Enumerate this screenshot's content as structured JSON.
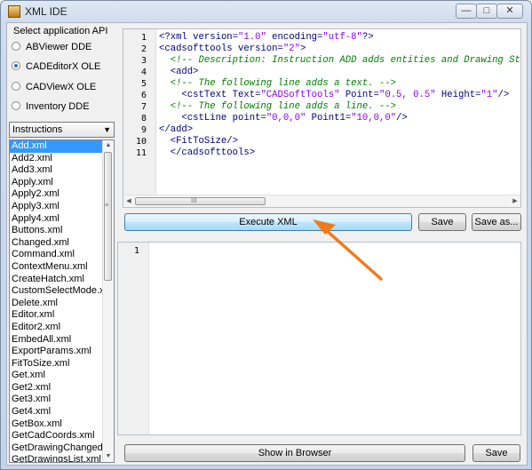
{
  "window": {
    "title": "XML IDE",
    "icon": "xml-ide-app-icon",
    "controls": {
      "minimize": "—",
      "maximize": "□",
      "close": "✕"
    }
  },
  "api": {
    "label": "Select application API",
    "options": [
      {
        "label": "ABViewer DDE",
        "selected": false
      },
      {
        "label": "CADEditorX OLE",
        "selected": true
      },
      {
        "label": "CADViewX OLE",
        "selected": false
      },
      {
        "label": "Inventory DDE",
        "selected": false
      }
    ]
  },
  "instructions": {
    "selected": "Instructions",
    "files": [
      "Add.xml",
      "Add2.xml",
      "Add3.xml",
      "Apply.xml",
      "Apply2.xml",
      "Apply3.xml",
      "Apply4.xml",
      "Buttons.xml",
      "Changed.xml",
      "Command.xml",
      "ContextMenu.xml",
      "CreateHatch.xml",
      "CustomSelectMode.xml",
      "Delete.xml",
      "Editor.xml",
      "Editor2.xml",
      "EmbedAll.xml",
      "ExportParams.xml",
      "FitToSize.xml",
      "Get.xml",
      "Get2.xml",
      "Get3.xml",
      "Get4.xml",
      "GetBox.xml",
      "GetCadCoords.xml",
      "GetDrawingChanged.xml",
      "GetDrawingsList.xml"
    ],
    "selected_file": "Add.xml"
  },
  "editor": {
    "line_numbers": [
      "1",
      "2",
      "3",
      "4",
      "5",
      "6",
      "7",
      "8",
      "9",
      "10",
      "11"
    ],
    "lines": [
      [
        [
          "pi",
          "<?xml "
        ],
        [
          "attr",
          "version="
        ],
        [
          "val",
          "\"1.0\""
        ],
        [
          "attr",
          " encoding="
        ],
        [
          "val",
          "\"utf-8\""
        ],
        [
          "pi",
          "?>"
        ]
      ],
      [
        [
          "tag",
          "<cadsofttools "
        ],
        [
          "attr",
          "version="
        ],
        [
          "val",
          "\"2\""
        ],
        [
          "tag",
          ">"
        ]
      ],
      [
        [
          "com",
          "  <!-- Description: Instruction ADD adds entities and Drawing St"
        ]
      ],
      [
        [
          "tag",
          "  <add>"
        ]
      ],
      [
        [
          "com",
          "  <!-- The following line adds a text. -->"
        ]
      ],
      [
        [
          "tag",
          "    <cstText "
        ],
        [
          "attr",
          "Text="
        ],
        [
          "val",
          "\"CADSoftTools\""
        ],
        [
          "attr",
          " Point="
        ],
        [
          "val",
          "\"0.5, 0.5\""
        ],
        [
          "attr",
          " Height="
        ],
        [
          "val",
          "\"1\""
        ],
        [
          "tag",
          "/>"
        ]
      ],
      [
        [
          "com",
          "  <!-- The following line adds a line. -->"
        ]
      ],
      [
        [
          "tag",
          "    <cstLine "
        ],
        [
          "attr",
          "point="
        ],
        [
          "val",
          "\"0,0,0\""
        ],
        [
          "attr",
          " Point1="
        ],
        [
          "val",
          "\"10,0,0\""
        ],
        [
          "tag",
          "/>"
        ]
      ],
      [
        [
          "tag",
          "</add>"
        ]
      ],
      [
        [
          "tag",
          "  <FitToSize/>"
        ]
      ],
      [
        [
          "tag",
          "  </cadsofttools>"
        ]
      ]
    ],
    "hscroll_grip": "III"
  },
  "toolbar": {
    "execute_label": "Execute XML",
    "save_label": "Save",
    "save_as_label": "Save as..."
  },
  "output": {
    "line_numbers": [
      "1"
    ]
  },
  "bottom": {
    "show_browser_label": "Show in Browser",
    "save_label": "Save"
  },
  "colors": {
    "annotation_arrow": "#f07a1c",
    "selection": "#3399ff"
  }
}
